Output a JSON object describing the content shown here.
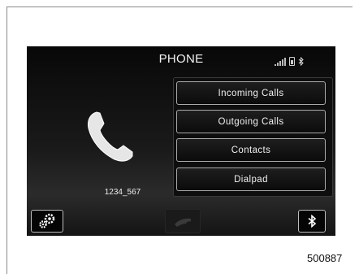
{
  "screen": {
    "title": "PHONE",
    "status_icons": [
      "signal-strength-icon",
      "battery-icon",
      "bluetooth-icon"
    ],
    "caller": "1234_567"
  },
  "menu": {
    "items": [
      {
        "label": "Incoming Calls"
      },
      {
        "label": "Outgoing Calls"
      },
      {
        "label": "Contacts"
      },
      {
        "label": "Dialpad"
      }
    ]
  },
  "bottom_bar": {
    "left_icon": "settings-gears-icon",
    "center_icon": "handset-icon",
    "right_icon": "bluetooth-icon"
  },
  "figure_code": "500887",
  "colors": {
    "screen_bg": "#0a0a0a",
    "button_border": "#a9a9a9",
    "text": "#f0f0f0"
  }
}
